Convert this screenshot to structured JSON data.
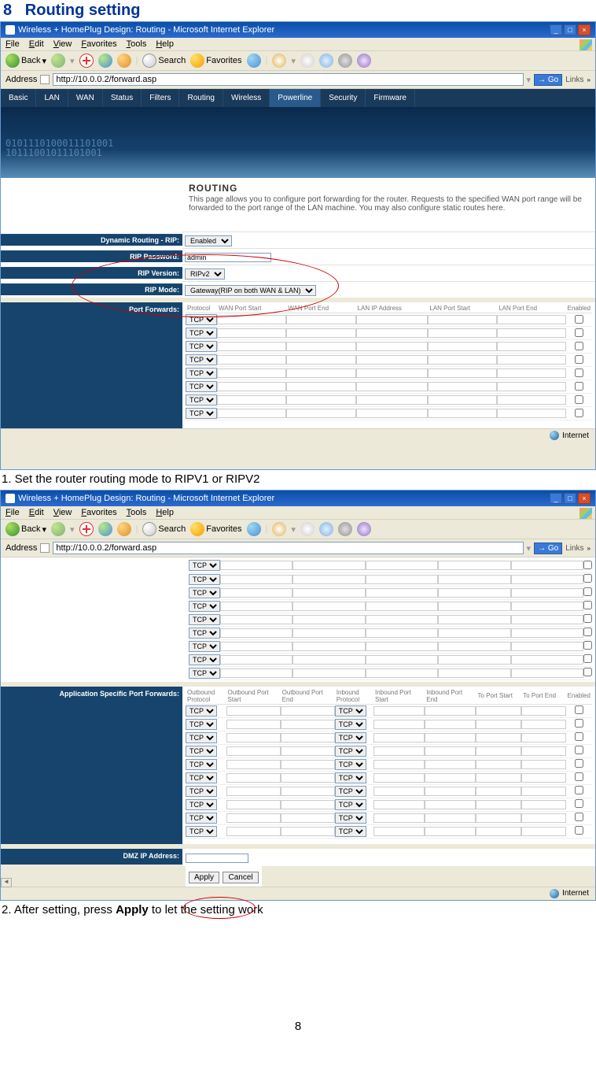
{
  "section": {
    "number": "8",
    "title": "Routing setting"
  },
  "caption1": "1. Set the router routing mode to RIPV1 or RIPV2",
  "caption2_prefix": "2. After setting, press ",
  "caption2_bold": "Apply",
  "caption2_suffix": " to let the setting work",
  "page_number": "8",
  "ie": {
    "title": "Wireless + HomePlug Design: Routing - Microsoft Internet Explorer",
    "menus": [
      "File",
      "Edit",
      "View",
      "Favorites",
      "Tools",
      "Help"
    ],
    "back": "Back",
    "search": "Search",
    "favorites": "Favorites",
    "address_label": "Address",
    "address_value": "http://10.0.0.2/forward.asp",
    "go": "Go",
    "links": "Links",
    "status": "Internet"
  },
  "router": {
    "tabs": [
      "Basic",
      "LAN",
      "WAN",
      "Status",
      "Filters",
      "Routing",
      "Wireless",
      "Powerline",
      "Security",
      "Firmware"
    ],
    "active_tab": "Powerline",
    "heading": "ROUTING",
    "desc": "This page allows you to configure port forwarding for the router. Requests to the specified WAN port range will be forwarded to the port range of the LAN machine. You may also configure static routes here.",
    "binary1": "0101110100011101001",
    "binary2": "10111001011101001",
    "dyn": {
      "rip_label": "Dynamic Routing - RIP:",
      "rip_value": "Enabled",
      "pass_label": "RIP Password:",
      "pass_value": "admin",
      "ver_label": "RIP Version:",
      "ver_value": "RIPv2",
      "mode_label": "RIP Mode:",
      "mode_value": "Gateway(RIP on both WAN & LAN)"
    },
    "pf": {
      "label": "Port Forwards:",
      "headers": [
        "Protocol",
        "WAN Port Start",
        "WAN Port End",
        "LAN IP Address",
        "LAN Port Start",
        "LAN Port End",
        "Enabled"
      ],
      "rows": 8,
      "proto": "TCP"
    },
    "pf2_rows": 9,
    "aspf": {
      "label": "Application Specific Port Forwards:",
      "headers": [
        "Outbound Protocol",
        "Outbound Port Start",
        "Outbound Port End",
        "Inbound Protocol",
        "Inbound Port Start",
        "Inbound Port End",
        "To Port Start",
        "To Port End",
        "Enabled"
      ],
      "rows": 10
    },
    "dmz_label": "DMZ IP Address:",
    "apply": "Apply",
    "cancel": "Cancel"
  }
}
